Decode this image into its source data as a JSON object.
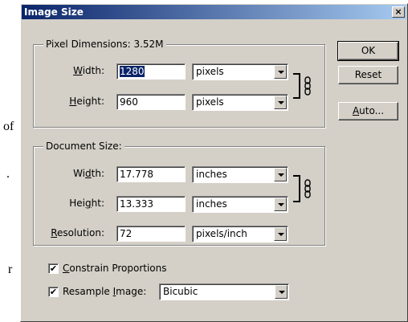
{
  "background_text": [
    "of",
    ".",
    "r"
  ],
  "window": {
    "title": "Image Size",
    "close_glyph": "×"
  },
  "pixel_dimensions": {
    "legend": "Pixel Dimensions: 3.52M",
    "width": {
      "label_pre": "",
      "label_u": "W",
      "label_post": "idth:",
      "value": "1280",
      "unit": "pixels"
    },
    "height": {
      "label_pre": "",
      "label_u": "H",
      "label_post": "eight:",
      "value": "960",
      "unit": "pixels"
    }
  },
  "document_size": {
    "legend": "Document Size:",
    "width": {
      "label_pre": "Wi",
      "label_u": "d",
      "label_post": "th:",
      "value": "17.778",
      "unit": "inches"
    },
    "height": {
      "label_pre": "Hei",
      "label_u": "g",
      "label_post": "ht:",
      "value": "13.333",
      "unit": "inches"
    },
    "resolution": {
      "label_pre": "",
      "label_u": "R",
      "label_post": "esolution:",
      "value": "72",
      "unit": "pixels/inch"
    }
  },
  "options": {
    "constrain": {
      "label_pre": "",
      "label_u": "C",
      "label_post": "onstrain Proportions",
      "checked": true,
      "mark": "✔"
    },
    "resample": {
      "label_pre": "Resample ",
      "label_u": "I",
      "label_post": "mage:",
      "checked": true,
      "mark": "✔",
      "method": "Bicubic"
    }
  },
  "buttons": {
    "ok": "OK",
    "reset": "Reset",
    "auto_u": "A",
    "auto_post": "uto..."
  },
  "icons": {
    "link": "chain-link-icon",
    "dropdown": "chevron-down-icon"
  }
}
